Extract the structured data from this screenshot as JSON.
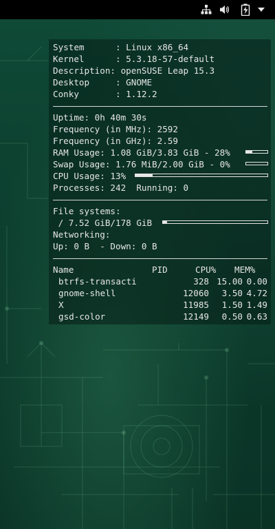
{
  "topbar": {
    "icons": [
      "network-wired-icon",
      "volume-icon",
      "battery-charging-icon",
      "system-menu-arrow-icon"
    ]
  },
  "conky": {
    "system_label": "System      : Linux x86_64",
    "kernel_label": "Kernel      : 5.3.18-57-default",
    "description_label": "Description: openSUSE Leap 15.3",
    "desktop_label": "Desktop     : GNOME",
    "conky_label": "Conky       : 1.12.2",
    "uptime": "Uptime: 0h 40m 30s",
    "freq_mhz": "Frequency (in MHz): 2592",
    "freq_ghz": "Frequency (in GHz): 2.59",
    "ram": "RAM Usage: 1.08 GiB/3.83 GiB - 28%",
    "ram_percent": 28,
    "swap": "Swap Usage: 1.76 MiB/2.00 GiB - 0%",
    "swap_percent": 0,
    "cpu": "CPU Usage: 13%",
    "cpu_percent": 13,
    "processes": "Processes: 242  Running: 0",
    "fs_title": "File systems:",
    "fs_root": " / 7.52 GiB/178 GiB",
    "fs_percent": 4,
    "net_title": "Networking:",
    "net_line": "Up: 0 B  - Down: 0 B",
    "table": {
      "headers": [
        "Name",
        "PID",
        "CPU%",
        "MEM%"
      ],
      "rows": [
        [
          "btrfs-transacti",
          "328",
          "15.00",
          "0.00"
        ],
        [
          "gnome-shell",
          "12060",
          "3.50",
          "4.72"
        ],
        [
          "X",
          "11985",
          "1.50",
          "1.49"
        ],
        [
          "gsd-color",
          "12149",
          "0.50",
          "0.63"
        ]
      ]
    }
  }
}
